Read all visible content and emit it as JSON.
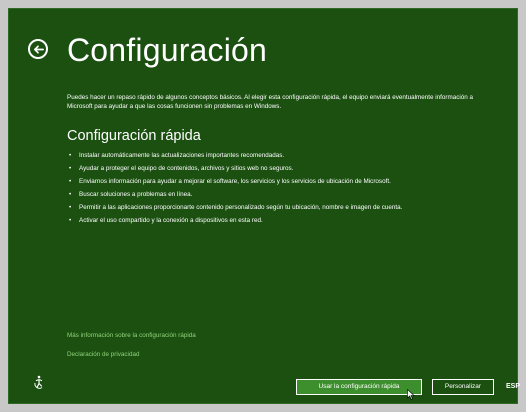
{
  "header": {
    "back_icon": "back-arrow-icon",
    "title": "Configuración"
  },
  "intro_text": "Puedes hacer un repaso rápido de algunos conceptos básicos. Al elegir esta configuración rápida, el equipo enviará eventualmente información a Microsoft para ayudar a que las cosas funcionen sin problemas en Windows.",
  "express": {
    "subtitle": "Configuración rápida",
    "items": [
      "Instalar automáticamente las actualizaciones importantes recomendadas.",
      "Ayudar a proteger el equipo de contenidos, archivos y sitios web no seguros.",
      "Enviarnos información para ayudar a mejorar el software, los servicios y los servicios de ubicación de Microsoft.",
      "Buscar soluciones a problemas en línea.",
      "Permitir a las aplicaciones proporcionarte contenido personalizado según tu ubicación, nombre e imagen de cuenta.",
      "Activar el uso compartido y la conexión a dispositivos en esta red."
    ]
  },
  "links": {
    "more_info": "Más información sobre la configuración rápida",
    "privacy": "Declaración de privacidad"
  },
  "footer": {
    "accessibility_icon": "ease-of-access-icon",
    "primary_button": "Usar la configuración rápida",
    "secondary_button": "Personalizar",
    "language": "ESP"
  },
  "colors": {
    "background": "#1b5011",
    "primary_button": "#3d8f2d",
    "link": "#8fd27a"
  }
}
